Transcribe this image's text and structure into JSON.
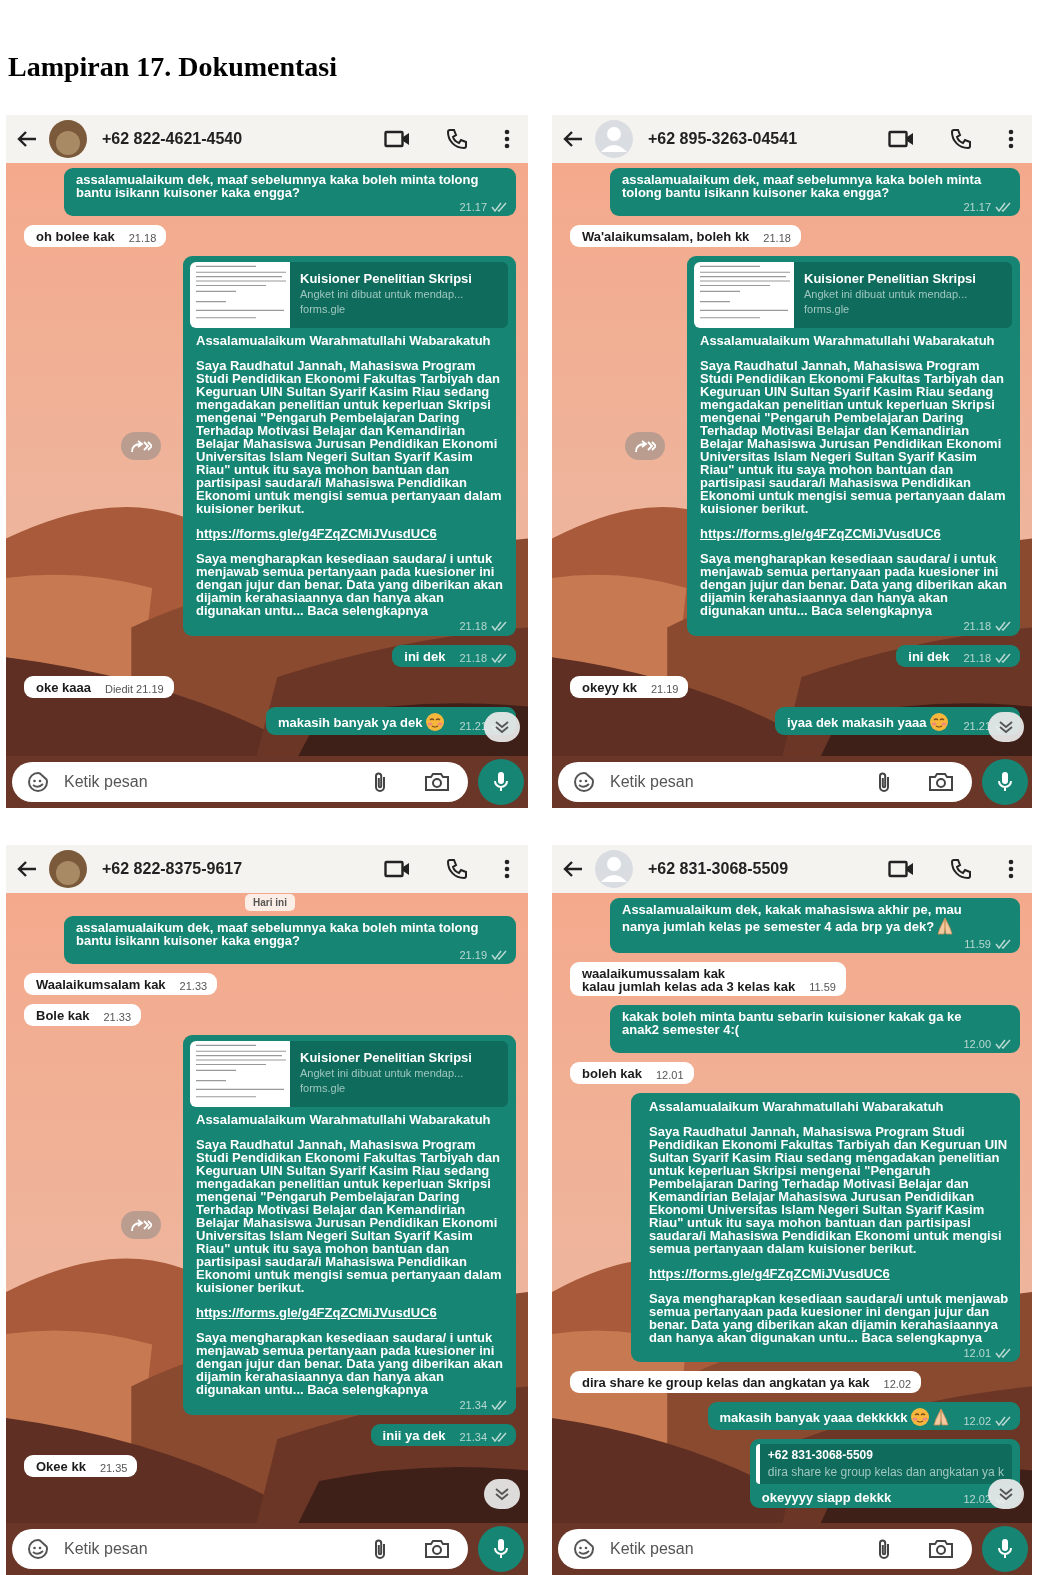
{
  "title": "Lampiran 17. Dokumentasi",
  "chats": [
    {
      "contact": "+62 822-4621-4540",
      "avatar_photo": true,
      "scroll_down_button": true,
      "input": {
        "placeholder": "Ketik pesan"
      },
      "messages": [
        {
          "kind": "text",
          "outgoing": true,
          "text": "assalamualaikum dek, maaf sebelumnya kaka boleh minta tolong bantu isikann kuisoner kaka engga?",
          "time": "21.17"
        },
        {
          "kind": "text",
          "outgoing": false,
          "text": "oh bolee kak",
          "time": "21.18"
        },
        {
          "kind": "link",
          "outgoing": true,
          "forward": true,
          "preview": {
            "title": "Kuisioner Penelitian Skripsi",
            "description": "Angket ini dibuat untuk mendap...",
            "domain": "forms.gle"
          },
          "greeting": "Assalamualaikum Warahmatullahi Wabarakatuh",
          "body": "Saya Raudhatul Jannah, Mahasiswa Program Studi Pendidikan Ekonomi Fakultas Tarbiyah dan Keguruan UIN Sultan Syarif Kasim Riau sedang mengadakan penelitian untuk keperluan Skripsi mengenai \"Pengaruh Pembelajaran Daring Terhadap Motivasi Belajar dan Kemandirian Belajar Mahasiswa Jurusan Pendidikan Ekonomi Universitas Islam Negeri Sultan Syarif Kasim Riau\" untuk itu saya mohon bantuan dan partisipasi saudara/i Mahasiswa Pendidikan Ekonomi untuk mengisi semua pertanyaan dalam kuisioner berikut.",
          "url": "https://forms.gle/g4FZqZCMiJVusdUC6",
          "closing": "Saya mengharapkan kesediaan saudara/ i untuk menjawab semua pertanyaan pada kuesioner ini dengan jujur dan benar. Data yang diberikan akan dijamin kerahasiaannya dan hanya akan digunakan untu... **Baca selengkapnya**",
          "time": "21.18"
        },
        {
          "kind": "text",
          "outgoing": true,
          "text": "ini dek",
          "time": "21.18"
        },
        {
          "kind": "text",
          "outgoing": false,
          "text": "oke kaaa",
          "time": "Diedit 21.19"
        },
        {
          "kind": "text",
          "outgoing": true,
          "text": "makasih banyak ya dek",
          "face_emoji": true,
          "time": "21.21"
        }
      ]
    },
    {
      "contact": "+62 895-3263-04541",
      "avatar_photo": false,
      "scroll_down_button": true,
      "input": {
        "placeholder": "Ketik pesan"
      },
      "messages": [
        {
          "kind": "text",
          "outgoing": true,
          "text": "assalamualaikum dek, maaf sebelumnya kaka boleh minta tolong bantu isikann kuisoner kaka engga?",
          "time": "21.17"
        },
        {
          "kind": "text",
          "outgoing": false,
          "text": "Wa'alaikumsalam, boleh kk",
          "time": "21.18"
        },
        {
          "kind": "link",
          "outgoing": true,
          "forward": true,
          "preview": {
            "title": "Kuisioner Penelitian Skripsi",
            "description": "Angket ini dibuat untuk mendap...",
            "domain": "forms.gle"
          },
          "greeting": "Assalamualaikum Warahmatullahi Wabarakatuh",
          "body": "Saya Raudhatul Jannah, Mahasiswa Program Studi Pendidikan Ekonomi Fakultas Tarbiyah dan Keguruan UIN Sultan Syarif Kasim Riau sedang mengadakan penelitian untuk keperluan Skripsi mengenai \"Pengaruh Pembelajaran Daring Terhadap Motivasi Belajar dan Kemandirian Belajar Mahasiswa Jurusan Pendidikan Ekonomi Universitas Islam Negeri Sultan Syarif Kasim Riau\" untuk itu saya mohon bantuan dan partisipasi saudara/i Mahasiswa Pendidikan Ekonomi untuk mengisi semua pertanyaan dalam kuisioner berikut.",
          "url": "https://forms.gle/g4FZqZCMiJVusdUC6",
          "closing": "Saya mengharapkan kesediaan saudara/ i untuk menjawab semua pertanyaan pada kuesioner ini dengan jujur dan benar. Data yang diberikan akan dijamin kerahasiaannya dan hanya akan digunakan untu... **Baca selengkapnya**",
          "time": "21.18"
        },
        {
          "kind": "text",
          "outgoing": true,
          "text": "ini dek",
          "time": "21.18"
        },
        {
          "kind": "text",
          "outgoing": false,
          "text": "okeyy kk",
          "time": "21.19"
        },
        {
          "kind": "text",
          "outgoing": true,
          "text": "iyaa dek makasih yaaa",
          "face_emoji": true,
          "time": "21.21"
        }
      ]
    },
    {
      "contact": "+62 822-8375-9617",
      "avatar_photo": true,
      "scroll_down_button": true,
      "input": {
        "placeholder": "Ketik pesan"
      },
      "messages": [
        {
          "kind": "date",
          "text": "Hari ini"
        },
        {
          "kind": "text",
          "outgoing": true,
          "text": "assalamualaikum dek, maaf sebelumnya kaka boleh minta tolong bantu isikann kuisoner kaka engga?",
          "time": "21.19"
        },
        {
          "kind": "text",
          "outgoing": false,
          "text": "Waalaikumsalam kak",
          "time": "21.33"
        },
        {
          "kind": "text",
          "outgoing": false,
          "text": "Bole kak",
          "time": "21.33"
        },
        {
          "kind": "link",
          "outgoing": true,
          "forward": true,
          "preview": {
            "title": "Kuisioner Penelitian Skripsi",
            "description": "Angket ini dibuat untuk mendap...",
            "domain": "forms.gle"
          },
          "greeting": "Assalamualaikum Warahmatullahi Wabarakatuh",
          "body": "Saya Raudhatul Jannah, Mahasiswa Program Studi Pendidikan Ekonomi Fakultas Tarbiyah dan Keguruan UIN Sultan Syarif Kasim Riau sedang mengadakan penelitian untuk keperluan Skripsi mengenai \"Pengaruh Pembelajaran Daring Terhadap Motivasi Belajar dan Kemandirian Belajar Mahasiswa Jurusan Pendidikan Ekonomi Universitas Islam Negeri Sultan Syarif Kasim Riau\" untuk itu saya mohon bantuan dan partisipasi saudara/i Mahasiswa Pendidikan Ekonomi untuk mengisi semua pertanyaan dalam kuisioner berikut.",
          "url": "https://forms.gle/g4FZqZCMiJVusdUC6",
          "closing": "Saya mengharapkan kesediaan saudara/ i untuk menjawab semua pertanyaan pada kuesioner ini dengan jujur dan benar. Data yang diberikan akan dijamin kerahasiaannya dan hanya akan digunakan untu... **Baca selengkapnya**",
          "time": "21.34"
        },
        {
          "kind": "text",
          "outgoing": true,
          "text": "inii ya dek",
          "time": "21.34"
        },
        {
          "kind": "text",
          "outgoing": false,
          "text": "Okee kk",
          "time": "21.35"
        }
      ]
    },
    {
      "contact": "+62 831-3068-5509",
      "avatar_photo": false,
      "scroll_down_button": true,
      "input": {
        "placeholder": "Ketik pesan"
      },
      "messages": [
        {
          "kind": "text",
          "outgoing": true,
          "text": "Assalamualaikum dek, kakak mahasiswa akhir pe, mau nanya  jumlah kelas pe semester 4 ada brp ya dek?",
          "hands_emoji": true,
          "time": "11.59"
        },
        {
          "kind": "text",
          "outgoing": false,
          "text": "waalaikumussalam kak\nkalau jumlah kelas ada 3 kelas kak",
          "time": "11.59"
        },
        {
          "kind": "text",
          "outgoing": true,
          "text": "kakak boleh minta bantu sebarin kuisioner kakak ga ke anak2 semester 4:(",
          "time": "12.00"
        },
        {
          "kind": "text",
          "outgoing": false,
          "text": "boleh kak",
          "time": "12.01"
        },
        {
          "kind": "link",
          "outgoing": true,
          "forward": false,
          "greeting": "Assalamualaikum Warahmatullahi Wabarakatuh",
          "body": "Saya Raudhatul Jannah, Mahasiswa Program Studi Pendidikan Ekonomi Fakultas Tarbiyah dan Keguruan UIN Sultan Syarif Kasim Riau sedang mengadakan penelitian untuk keperluan Skripsi mengenai \"Pengaruh Pembelajaran Daring Terhadap Motivasi Belajar dan Kemandirian Belajar Mahasiswa Jurusan Pendidikan Ekonomi Universitas Islam Negeri Sultan Syarif Kasim Riau\" untuk itu saya mohon bantuan dan partisipasi saudara/i Mahasiswa Pendidikan Ekonomi untuk mengisi semua pertanyaan dalam kuisioner berikut.",
          "url": "https://forms.gle/g4FZqZCMiJVusdUC6",
          "closing": "Saya mengharapkan kesediaan saudara/i untuk menjawab semua pertanyaan pada kuesioner ini dengan jujur dan benar. Data yang diberikan akan dijamin kerahasiaannya dan hanya akan digunakan untu... **Baca selengkapnya**",
          "time": "12.01"
        },
        {
          "kind": "text",
          "outgoing": false,
          "text": "dira share ke group kelas dan angkatan ya kak",
          "time": "12.02"
        },
        {
          "kind": "text",
          "outgoing": true,
          "text": "makasih banyak yaaa dekkkkk",
          "face_emoji": true,
          "hands_emoji": true,
          "time": "12.02"
        },
        {
          "kind": "reply",
          "outgoing": true,
          "quote_author": "+62 831-3068-5509",
          "quote_text": "dira share ke group kelas dan angkatan ya k",
          "text": "okeyyyy siapp dekkk",
          "time": "12.02"
        }
      ]
    }
  ]
}
